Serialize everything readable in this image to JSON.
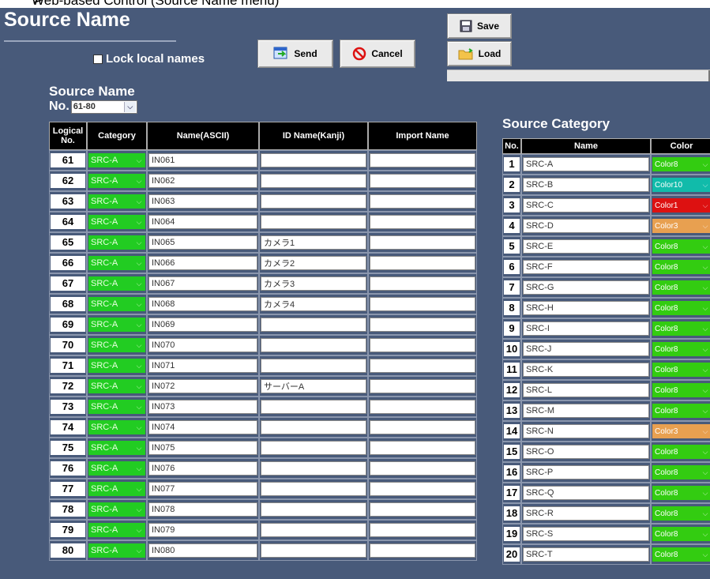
{
  "doc_heading": "Web-based Control (Source Name menu)",
  "title": "Source Name",
  "lock_label": "Lock local names",
  "buttons": {
    "send": "Send",
    "cancel": "Cancel",
    "save": "Save",
    "load": "Load"
  },
  "source_name": {
    "heading": "Source Name",
    "no_label": "No.",
    "range": "61-80",
    "headers": [
      "Logical No.",
      "Category",
      "Name(ASCII)",
      "ID Name(Kanji)",
      "Import Name"
    ],
    "rows": [
      {
        "no": "61",
        "category": "SRC-A",
        "ascii": "IN061",
        "kanji": "",
        "import": ""
      },
      {
        "no": "62",
        "category": "SRC-A",
        "ascii": "IN062",
        "kanji": "",
        "import": ""
      },
      {
        "no": "63",
        "category": "SRC-A",
        "ascii": "IN063",
        "kanji": "",
        "import": ""
      },
      {
        "no": "64",
        "category": "SRC-A",
        "ascii": "IN064",
        "kanji": "",
        "import": ""
      },
      {
        "no": "65",
        "category": "SRC-A",
        "ascii": "IN065",
        "kanji": "カメラ1",
        "import": ""
      },
      {
        "no": "66",
        "category": "SRC-A",
        "ascii": "IN066",
        "kanji": "カメラ2",
        "import": ""
      },
      {
        "no": "67",
        "category": "SRC-A",
        "ascii": "IN067",
        "kanji": "カメラ3",
        "import": ""
      },
      {
        "no": "68",
        "category": "SRC-A",
        "ascii": "IN068",
        "kanji": "カメラ4",
        "import": ""
      },
      {
        "no": "69",
        "category": "SRC-A",
        "ascii": "IN069",
        "kanji": "",
        "import": ""
      },
      {
        "no": "70",
        "category": "SRC-A",
        "ascii": "IN070",
        "kanji": "",
        "import": ""
      },
      {
        "no": "71",
        "category": "SRC-A",
        "ascii": "IN071",
        "kanji": "",
        "import": ""
      },
      {
        "no": "72",
        "category": "SRC-A",
        "ascii": "IN072",
        "kanji": "サーバーA",
        "import": ""
      },
      {
        "no": "73",
        "category": "SRC-A",
        "ascii": "IN073",
        "kanji": "",
        "import": ""
      },
      {
        "no": "74",
        "category": "SRC-A",
        "ascii": "IN074",
        "kanji": "",
        "import": ""
      },
      {
        "no": "75",
        "category": "SRC-A",
        "ascii": "IN075",
        "kanji": "",
        "import": ""
      },
      {
        "no": "76",
        "category": "SRC-A",
        "ascii": "IN076",
        "kanji": "",
        "import": ""
      },
      {
        "no": "77",
        "category": "SRC-A",
        "ascii": "IN077",
        "kanji": "",
        "import": ""
      },
      {
        "no": "78",
        "category": "SRC-A",
        "ascii": "IN078",
        "kanji": "",
        "import": ""
      },
      {
        "no": "79",
        "category": "SRC-A",
        "ascii": "IN079",
        "kanji": "",
        "import": ""
      },
      {
        "no": "80",
        "category": "SRC-A",
        "ascii": "IN080",
        "kanji": "",
        "import": ""
      }
    ]
  },
  "source_category": {
    "heading": "Source Category",
    "headers": [
      "No.",
      "Name",
      "Color"
    ],
    "rows": [
      {
        "no": "1",
        "name": "SRC-A",
        "color": "Color8",
        "hex": "#33cc11"
      },
      {
        "no": "2",
        "name": "SRC-B",
        "color": "Color10",
        "hex": "#11bbaa"
      },
      {
        "no": "3",
        "name": "SRC-C",
        "color": "Color1",
        "hex": "#dd1111"
      },
      {
        "no": "4",
        "name": "SRC-D",
        "color": "Color3",
        "hex": "#e8a050"
      },
      {
        "no": "5",
        "name": "SRC-E",
        "color": "Color8",
        "hex": "#33cc11"
      },
      {
        "no": "6",
        "name": "SRC-F",
        "color": "Color8",
        "hex": "#33cc11"
      },
      {
        "no": "7",
        "name": "SRC-G",
        "color": "Color8",
        "hex": "#33cc11"
      },
      {
        "no": "8",
        "name": "SRC-H",
        "color": "Color8",
        "hex": "#33cc11"
      },
      {
        "no": "9",
        "name": "SRC-I",
        "color": "Color8",
        "hex": "#33cc11"
      },
      {
        "no": "10",
        "name": "SRC-J",
        "color": "Color8",
        "hex": "#33cc11"
      },
      {
        "no": "11",
        "name": "SRC-K",
        "color": "Color8",
        "hex": "#33cc11"
      },
      {
        "no": "12",
        "name": "SRC-L",
        "color": "Color8",
        "hex": "#33cc11"
      },
      {
        "no": "13",
        "name": "SRC-M",
        "color": "Color8",
        "hex": "#33cc11"
      },
      {
        "no": "14",
        "name": "SRC-N",
        "color": "Color3",
        "hex": "#e8a050"
      },
      {
        "no": "15",
        "name": "SRC-O",
        "color": "Color8",
        "hex": "#33cc11"
      },
      {
        "no": "16",
        "name": "SRC-P",
        "color": "Color8",
        "hex": "#33cc11"
      },
      {
        "no": "17",
        "name": "SRC-Q",
        "color": "Color8",
        "hex": "#33cc11"
      },
      {
        "no": "18",
        "name": "SRC-R",
        "color": "Color8",
        "hex": "#33cc11"
      },
      {
        "no": "19",
        "name": "SRC-S",
        "color": "Color8",
        "hex": "#33cc11"
      },
      {
        "no": "20",
        "name": "SRC-T",
        "color": "Color8",
        "hex": "#33cc11"
      }
    ]
  }
}
